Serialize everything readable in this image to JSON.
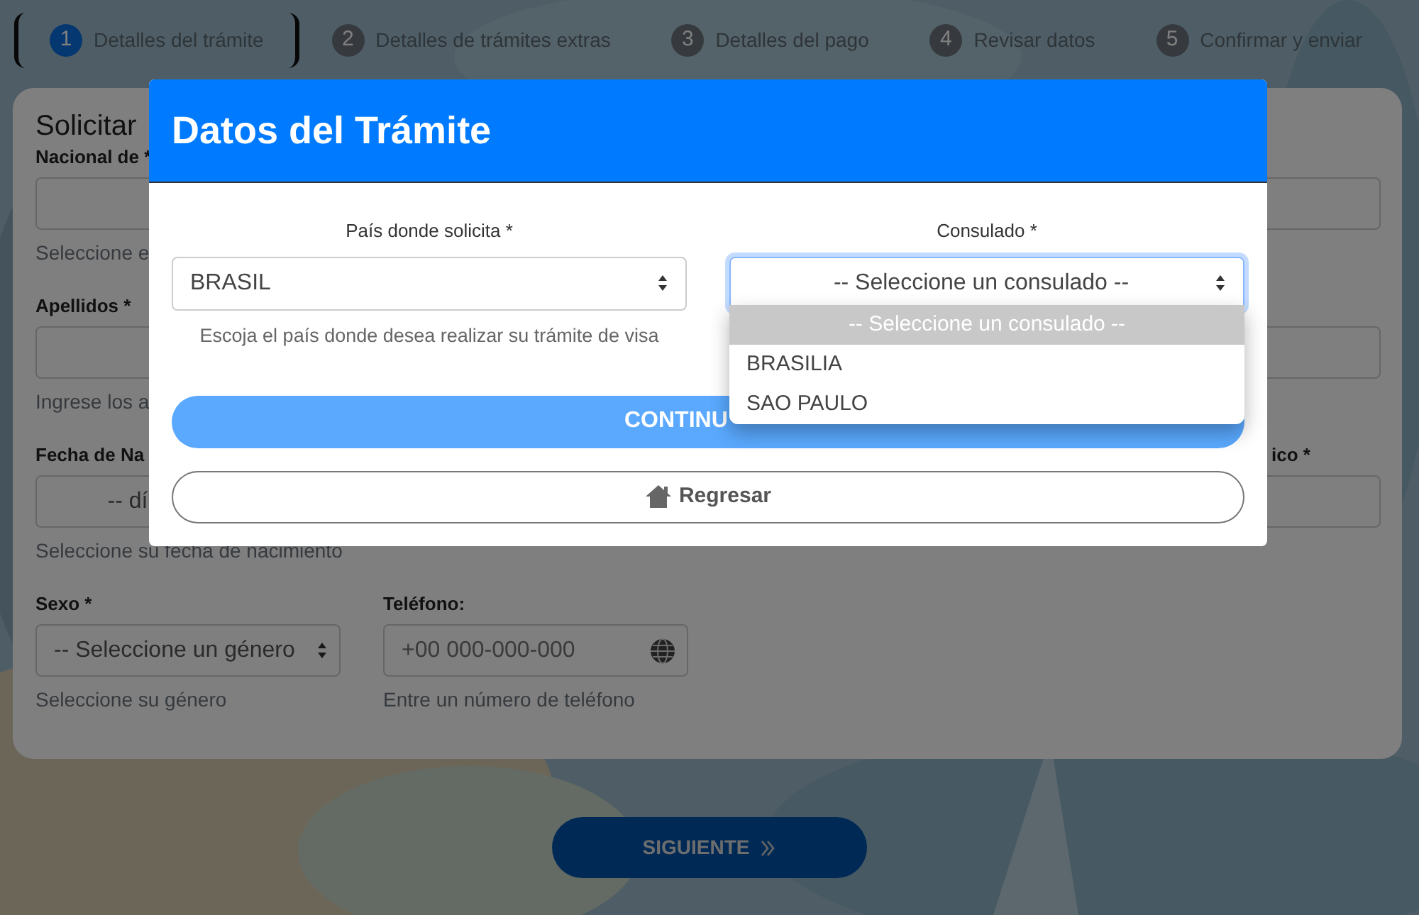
{
  "steps": [
    {
      "number": "1",
      "label": "Detalles del trámite",
      "selected": true
    },
    {
      "number": "2",
      "label": "Detalles de trámites extras",
      "selected": false
    },
    {
      "number": "3",
      "label": "Detalles del pago",
      "selected": false
    },
    {
      "number": "4",
      "label": "Revisar datos",
      "selected": false
    },
    {
      "number": "5",
      "label": "Confirmar y enviar",
      "selected": false
    }
  ],
  "form": {
    "title": "Solicitar",
    "rows": [
      [
        {
          "kind": "text",
          "label": "Nacional de *",
          "help": "Seleccione e"
        }
      ],
      [
        {
          "kind": "text",
          "label": "Apellidos *",
          "help": "Ingrese los a"
        }
      ],
      [
        {
          "kind": "small-select",
          "label": "Fecha de Na",
          "value": "-- dí",
          "help": "Seleccione su fecha de nacimiento"
        },
        {
          "kind": "text",
          "label": "ico *"
        }
      ],
      [
        {
          "kind": "select",
          "label": "Sexo *",
          "value": "-- Seleccione un género",
          "help": "Seleccione su género"
        },
        {
          "kind": "phone",
          "label": "Teléfono:",
          "placeholder": "+00 000-000-000",
          "help": "Entre un número de teléfono"
        }
      ]
    ]
  },
  "next_button": {
    "label": "SIGUIENTE"
  },
  "modal": {
    "title": "Datos del Trámite",
    "fields": [
      {
        "kind": "country",
        "label": "País donde solicita *",
        "value": "BRASIL",
        "focused": false,
        "help": "Escoja el país donde desea realizar su trámite de visa"
      },
      {
        "kind": "consulate",
        "label": "Consulado *",
        "value": "-- Seleccione un consulado --",
        "focused": true,
        "options": [
          {
            "label": "-- Seleccione un consulado --",
            "selected": true
          },
          {
            "label": "BRASILIA",
            "selected": false
          },
          {
            "label": "SAO PAULO",
            "selected": false
          }
        ]
      }
    ],
    "continue_button": {
      "label": "CONTINU"
    },
    "back_button": {
      "label": "Regresar"
    }
  }
}
